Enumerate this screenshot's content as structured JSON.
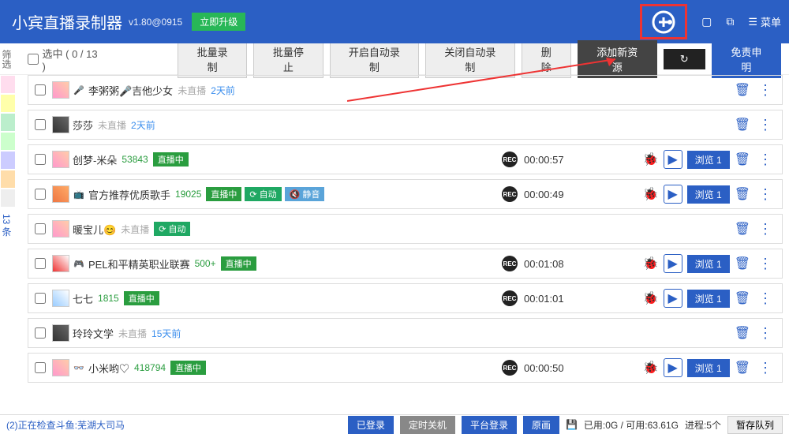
{
  "header": {
    "title": "小宾直播录制器",
    "version": "v1.80@0915",
    "upgrade": "立即升级",
    "menu": "菜单"
  },
  "toolbar": {
    "select_label": "选中 ( 0  /  13 )",
    "batch_record": "批量录制",
    "batch_stop": "批量停止",
    "auto_on": "开启自动录制",
    "auto_off": "关闭自动录制",
    "delete": "删除",
    "add_source": "添加新资源",
    "free_apply": "免责申明"
  },
  "sidebar": {
    "filter_label": "筛选",
    "count_label": "13 条"
  },
  "labels": {
    "offline": "未直播",
    "live": "直播中",
    "auto": "自动",
    "mute": "静音",
    "browse": "浏览",
    "rec": "REC"
  },
  "rows": [
    {
      "icon": "🎤",
      "name": "李粥粥🎤吉他少女",
      "offline": true,
      "timeAgo": "2天前",
      "avatar": ""
    },
    {
      "icon": "",
      "name": "莎莎",
      "offline": true,
      "timeAgo": "2天前",
      "avatar": "a2"
    },
    {
      "icon": "",
      "name": "创梦-米朵",
      "viewers": "53843",
      "live": true,
      "duration": "00:00:57",
      "browseCount": "1",
      "avatar": ""
    },
    {
      "icon": "📺",
      "name": "官方推荐优质歌手",
      "viewers": "19025",
      "live": true,
      "auto": true,
      "mute": true,
      "duration": "00:00:49",
      "browseCount": "1",
      "avatar": "a3"
    },
    {
      "icon": "",
      "name": "暖宝儿😊",
      "offline": true,
      "auto": true,
      "avatar": ""
    },
    {
      "icon": "🎮",
      "name": "PEL和平精英职业联赛",
      "viewers": "500+",
      "live": true,
      "duration": "00:01:08",
      "browseCount": "1",
      "avatar": "a4"
    },
    {
      "icon": "",
      "name": "七七",
      "viewers": "1815",
      "live": true,
      "duration": "00:01:01",
      "browseCount": "1",
      "avatar": "a5"
    },
    {
      "icon": "",
      "name": "玲玲文学",
      "offline": true,
      "timeAgo": "15天前",
      "avatar": "a2"
    },
    {
      "icon": "👓",
      "name": "小米哟♡",
      "viewers": "418794",
      "live": true,
      "duration": "00:00:50",
      "browseCount": "1",
      "avatar": ""
    }
  ],
  "footer": {
    "status": "(2)正在检查斗鱼:芜湖大司马",
    "logged_in": "已登录",
    "timer_shutdown": "定时关机",
    "platform_login": "平台登录",
    "original": "原画",
    "disk": "已用:0G / 可用:63.61G",
    "process": "进程:5个",
    "queue": "暂存队列"
  }
}
